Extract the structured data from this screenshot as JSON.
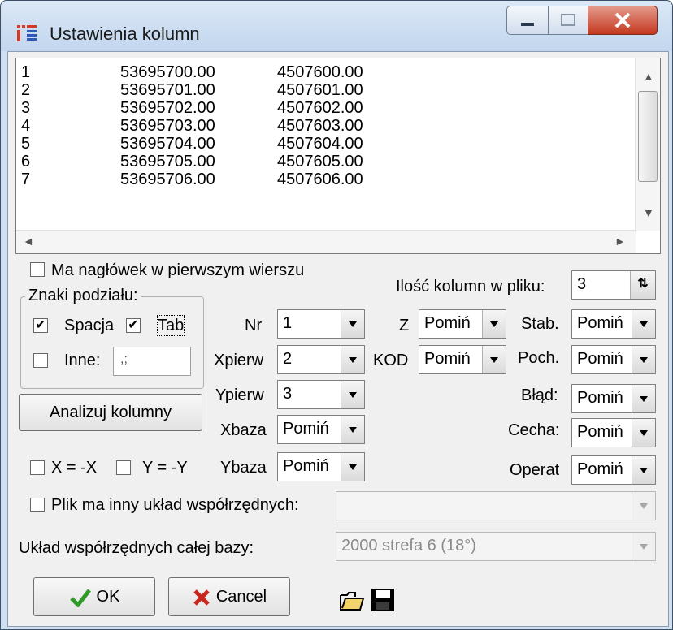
{
  "window": {
    "title": "Ustawienia kolumn"
  },
  "preview": {
    "rows": [
      [
        "1",
        "53695700.00",
        "4507600.00"
      ],
      [
        "2",
        "53695701.00",
        "4507601.00"
      ],
      [
        "3",
        "53695702.00",
        "4507602.00"
      ],
      [
        "4",
        "53695703.00",
        "4507603.00"
      ],
      [
        "5",
        "53695704.00",
        "4507604.00"
      ],
      [
        "6",
        "53695705.00",
        "4507605.00"
      ],
      [
        "7",
        "53695706.00",
        "4507606.00"
      ]
    ]
  },
  "options": {
    "header_label": "Ma nagłówek w pierwszym wierszu",
    "header_checked": false,
    "column_count_label": "Ilość kolumn w pliku:",
    "column_count": "3"
  },
  "separators": {
    "title": "Znaki podziału:",
    "space_label": "Spacja",
    "space_checked": true,
    "tab_label": "Tab",
    "tab_checked": true,
    "other_label": "Inne:",
    "other_checked": false,
    "other_value": ",;"
  },
  "analyze_button": "Analizuj kolumny",
  "flip": {
    "x_label": "X = -X",
    "y_label": "Y = -Y"
  },
  "fields_left": [
    {
      "label": "Nr",
      "value": "1"
    },
    {
      "label": "Xpierw",
      "value": "2"
    },
    {
      "label": "Ypierw",
      "value": "3"
    },
    {
      "label": "Xbaza",
      "value": "Pomiń"
    },
    {
      "label": "Ybaza",
      "value": "Pomiń"
    }
  ],
  "fields_mid": [
    {
      "label": "Z",
      "value": "Pomiń"
    },
    {
      "label": "KOD",
      "value": "Pomiń"
    }
  ],
  "fields_right": [
    {
      "label": "Stab.",
      "value": "Pomiń"
    },
    {
      "label": "Poch.",
      "value": "Pomiń"
    },
    {
      "label": "Błąd:",
      "value": "Pomiń"
    },
    {
      "label": "Cecha:",
      "value": "Pomiń"
    },
    {
      "label": "Operat",
      "value": "Pomiń"
    }
  ],
  "coord": {
    "file_label": "Plik ma inny układ współrzędnych:",
    "file_value": "",
    "base_label": "Układ współrzędnych całej bazy:",
    "base_value": "2000 strefa 6 (18°)"
  },
  "buttons": {
    "ok": "OK",
    "cancel": "Cancel"
  },
  "icons": {
    "ok": "checkmark-icon",
    "cancel": "x-icon",
    "open": "folder-open-icon",
    "save": "floppy-disk-icon"
  }
}
